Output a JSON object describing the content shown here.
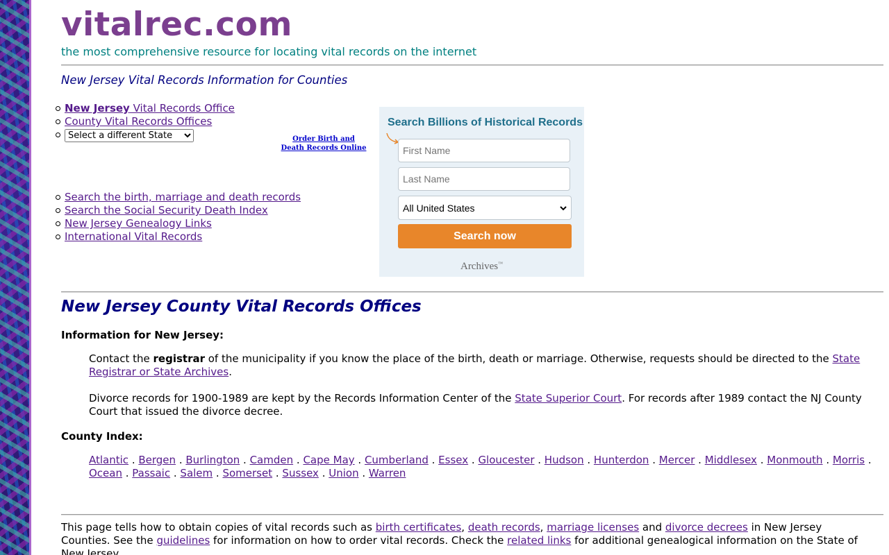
{
  "site": {
    "logo": "vitalrec.com",
    "tagline": "the most comprehensive resource for locating vital records on the internet"
  },
  "subheading": "New Jersey Vital Records Information for Counties",
  "nav_top": {
    "state_office_bold": "New Jersey",
    "state_office_rest": " Vital Records Office",
    "county_offices": "County Vital Records Offices",
    "state_select": "Select a different State"
  },
  "order_link": {
    "line1": "Order Birth and",
    "line2": "Death Records Online"
  },
  "nav_bottom": [
    "Search the birth, marriage and death records",
    "Search the Social Security Death Index",
    "New Jersey Genealogy Links",
    "International Vital Records"
  ],
  "search_widget": {
    "title": "Search Billions of Historical Records",
    "first_name_placeholder": "First Name",
    "last_name_placeholder": "Last Name",
    "country_value": "All United States",
    "button_label": "Search now",
    "brand": "Archives",
    "brand_tm": "™",
    "accent_color": "#e8862a",
    "title_color": "#1f6f8b"
  },
  "section_title": "New Jersey County Vital Records Offices",
  "info_label": "Information for New Jersey:",
  "para1": {
    "pre": "Contact the ",
    "bold": "registrar",
    "mid": " of the municipality if you know the place of the birth, death or marriage. Otherwise, requests should be directed to the ",
    "link": "State Registrar or State Archives",
    "post": "."
  },
  "para2": {
    "pre": "Divorce records for 1900-1989 are kept by the Records Information Center of the ",
    "link": "State Superior Court",
    "post": ". For records after 1989 contact the NJ County Court that issued the divorce decree."
  },
  "county_label": "County Index:",
  "counties": [
    "Atlantic",
    "Bergen",
    "Burlington",
    "Camden",
    "Cape May",
    "Cumberland",
    "Essex",
    "Gloucester",
    "Hudson",
    "Hunterdon",
    "Mercer",
    "Middlesex",
    "Monmouth",
    "Morris",
    "Ocean",
    "Passaic",
    "Salem",
    "Somerset",
    "Sussex",
    "Union",
    "Warren"
  ],
  "footer": {
    "t1": "This page tells how to obtain copies of vital records such as ",
    "l1": "birth certificates",
    "t2": ", ",
    "l2": "death records",
    "t3": ", ",
    "l3": "marriage licenses",
    "t4": " and ",
    "l4": "divorce decrees",
    "t5": " in New Jersey Counties. See the ",
    "l5": "guidelines",
    "t6": " for information on how to order vital records. Check the ",
    "l6": "related links",
    "t7": " for additional genealogical information on the State of New Jersey."
  },
  "colors": {
    "logo": "#7b3f8f",
    "tagline": "#008080",
    "heading": "#000080",
    "link": "#551a8b"
  }
}
